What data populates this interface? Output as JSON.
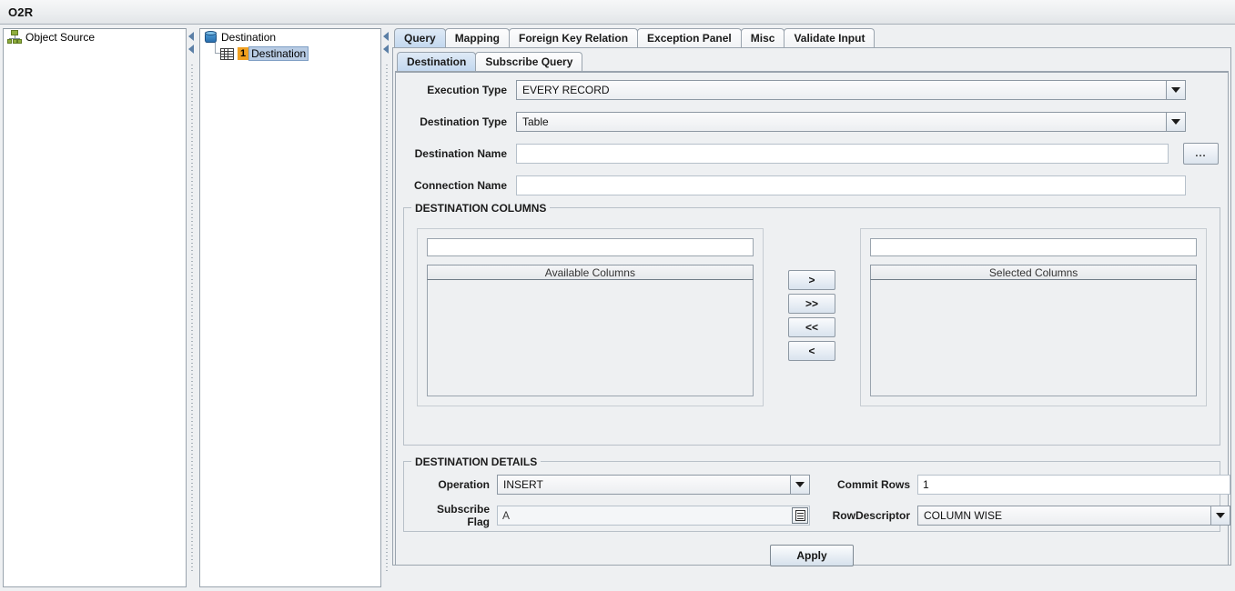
{
  "window": {
    "title": "O2R"
  },
  "trees": {
    "object_source": {
      "root_label": "Object Source",
      "root_icon": "object-source-icon"
    },
    "destination": {
      "root_label": "Destination",
      "root_icon": "database-icon",
      "child": {
        "badge": "1",
        "label": "Destination",
        "icon": "table-icon",
        "selected": true
      }
    }
  },
  "main_tabs": {
    "items": [
      {
        "label": "Query",
        "active": true
      },
      {
        "label": "Mapping",
        "active": false
      },
      {
        "label": "Foreign Key Relation",
        "active": false
      },
      {
        "label": "Exception Panel",
        "active": false
      },
      {
        "label": "Misc",
        "active": false
      },
      {
        "label": "Validate Input",
        "active": false
      }
    ]
  },
  "sub_tabs": {
    "items": [
      {
        "label": "Destination",
        "active": true
      },
      {
        "label": "Subscribe Query",
        "active": false
      }
    ]
  },
  "form": {
    "execution_type": {
      "label": "Execution Type",
      "value": "EVERY RECORD"
    },
    "destination_type": {
      "label": "Destination Type",
      "value": "Table"
    },
    "destination_name": {
      "label": "Destination Name",
      "value": "",
      "placeholder": ""
    },
    "connection_name": {
      "label": "Connection Name",
      "value": "",
      "placeholder": ""
    },
    "browse_button": "..."
  },
  "destination_columns": {
    "legend": "DESTINATION COLUMNS",
    "available": {
      "filter_value": "",
      "header": "Available Columns",
      "items": []
    },
    "selected": {
      "filter_value": "",
      "header": "Selected Columns",
      "items": []
    },
    "transfer_buttons": [
      {
        "label": ">",
        "name": "move-right-button"
      },
      {
        "label": ">>",
        "name": "move-all-right-button"
      },
      {
        "label": "<<",
        "name": "move-all-left-button"
      },
      {
        "label": "<",
        "name": "move-left-button"
      }
    ]
  },
  "destination_details": {
    "legend": "DESTINATION DETAILS",
    "operation": {
      "label": "Operation",
      "value": "INSERT"
    },
    "commit_rows": {
      "label": "Commit Rows",
      "value": "1"
    },
    "subscribe_flag": {
      "label": "Subscribe Flag",
      "value": "A"
    },
    "row_descriptor": {
      "label": "RowDescriptor",
      "value": "COLUMN WISE"
    }
  },
  "actions": {
    "apply": "Apply"
  },
  "colors": {
    "tab_active": "#c3d8ef",
    "selection": "#b8cce4",
    "badge": "#f0a020",
    "panel_bg": "#eef0f2"
  }
}
